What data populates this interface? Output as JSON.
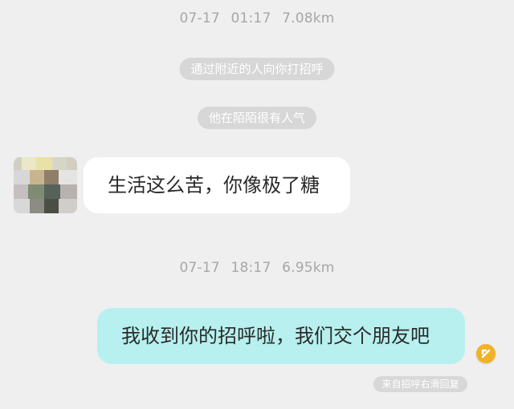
{
  "conversation": {
    "header_1": {
      "date": "07-17",
      "time": "01:17",
      "distance": "7.08km"
    },
    "system_messages": [
      {
        "text": "通过附近的人向你打招呼"
      },
      {
        "text": "他在陌陌很有人气"
      }
    ],
    "messages": [
      {
        "text": "生活这么苦，你像极了糖"
      },
      {
        "text": "我收到你的招呼啦，我们交个朋友吧"
      }
    ],
    "header_2": {
      "date": "07-17",
      "time": "18:17",
      "distance": "6.95km"
    },
    "reply_tag": "来自招呼右滑回复"
  },
  "colors": {
    "background": "#efefef",
    "incoming_bubble": "#ffffff",
    "outgoing_bubble": "#b7f0ee",
    "status_icon": "#f2b227"
  },
  "icons": {
    "status": "arrow-up-left-icon"
  }
}
